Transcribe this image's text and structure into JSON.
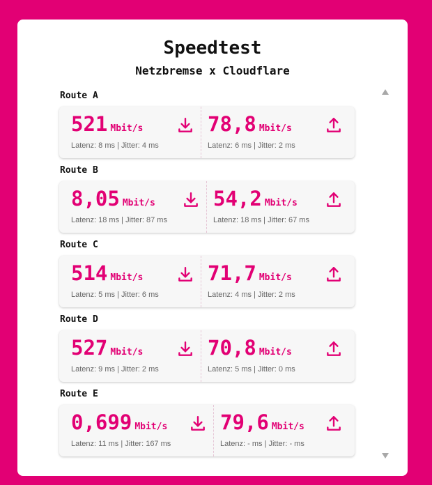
{
  "title": "Speedtest",
  "subtitle": "Netzbremse x Cloudflare",
  "accent_color": "#e20074",
  "routes": [
    {
      "label": "Route A",
      "download": {
        "value": "521",
        "unit": "Mbit/s",
        "latency": "Latenz: 8 ms | Jitter: 4 ms",
        "icon": "download-icon"
      },
      "upload": {
        "value": "78,8",
        "unit": "Mbit/s",
        "latency": "Latenz: 6 ms | Jitter: 2 ms",
        "icon": "upload-icon"
      }
    },
    {
      "label": "Route B",
      "download": {
        "value": "8,05",
        "unit": "Mbit/s",
        "latency": "Latenz: 18 ms | Jitter: 87 ms",
        "icon": "download-icon"
      },
      "upload": {
        "value": "54,2",
        "unit": "Mbit/s",
        "latency": "Latenz: 18 ms | Jitter: 67 ms",
        "icon": "upload-icon"
      }
    },
    {
      "label": "Route C",
      "download": {
        "value": "514",
        "unit": "Mbit/s",
        "latency": "Latenz: 5 ms | Jitter: 6 ms",
        "icon": "download-icon"
      },
      "upload": {
        "value": "71,7",
        "unit": "Mbit/s",
        "latency": "Latenz: 4 ms | Jitter: 2 ms",
        "icon": "upload-icon"
      }
    },
    {
      "label": "Route D",
      "download": {
        "value": "527",
        "unit": "Mbit/s",
        "latency": "Latenz: 9 ms | Jitter: 2 ms",
        "icon": "download-icon"
      },
      "upload": {
        "value": "70,8",
        "unit": "Mbit/s",
        "latency": "Latenz: 5 ms | Jitter: 0 ms",
        "icon": "upload-icon"
      }
    },
    {
      "label": "Route E",
      "download": {
        "value": "0,699",
        "unit": "Mbit/s",
        "latency": "Latenz: 11 ms | Jitter: 167 ms",
        "icon": "download-icon"
      },
      "upload": {
        "value": "79,6",
        "unit": "Mbit/s",
        "latency": "Latenz: - ms | Jitter: - ms",
        "icon": "upload-icon"
      }
    }
  ]
}
